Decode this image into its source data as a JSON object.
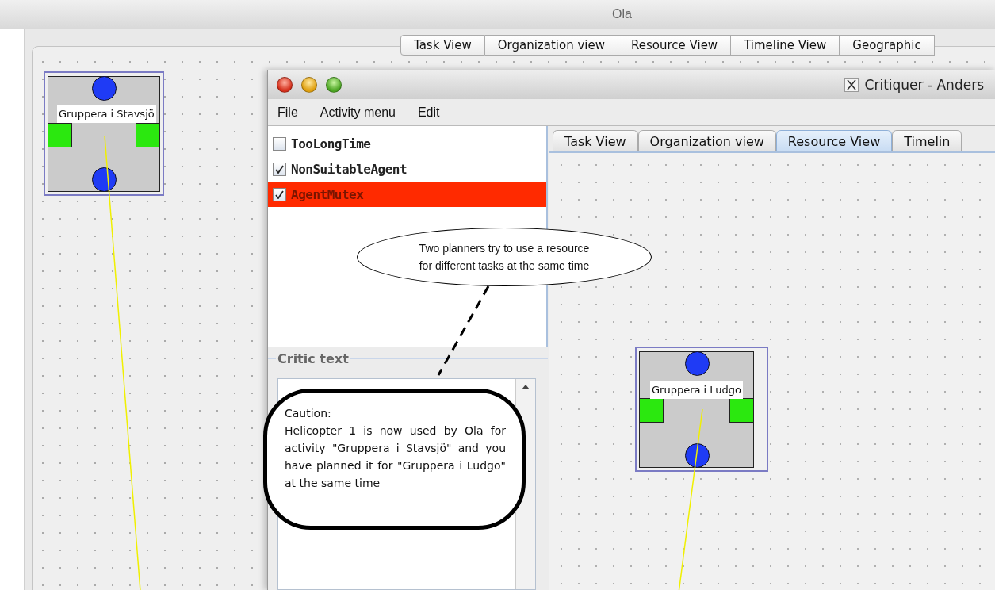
{
  "back_window": {
    "title": "Ola",
    "tabs": [
      {
        "label": "Task View",
        "selected": false
      },
      {
        "label": "Organization view",
        "selected": false
      },
      {
        "label": "Resource View",
        "selected": false
      },
      {
        "label": "Timeline View",
        "selected": false
      },
      {
        "label": "Geographic",
        "selected": false
      }
    ],
    "node": {
      "label": "Gruppera i Stavsjö"
    }
  },
  "front_window": {
    "title": "Critiquer - Anders",
    "menu": [
      "File",
      "Activity menu",
      "Edit"
    ],
    "critics": [
      {
        "label": "TooLongTime",
        "checked": false,
        "selected": false
      },
      {
        "label": "NonSuitableAgent",
        "checked": true,
        "selected": false
      },
      {
        "label": "AgentMutex",
        "checked": true,
        "selected": true
      }
    ],
    "critic_text_title": "Critic text",
    "tabs": [
      {
        "label": "Task View",
        "selected": false
      },
      {
        "label": "Organization view",
        "selected": false
      },
      {
        "label": "Resource View",
        "selected": true
      },
      {
        "label": "Timelin",
        "selected": false
      }
    ],
    "node": {
      "label": "Gruppera i Ludgo"
    }
  },
  "callouts": [
    {
      "kind": "oval",
      "text": "Two planners try to use a resource for different tasks at the same time"
    },
    {
      "kind": "rounded",
      "title": "Caution:",
      "text": "Helicopter 1 is now used by Ola for activity \"Gruppera i Stavsjö\" and you have planned it for \"Gruppera i Ludgo\" at the same time"
    }
  ]
}
